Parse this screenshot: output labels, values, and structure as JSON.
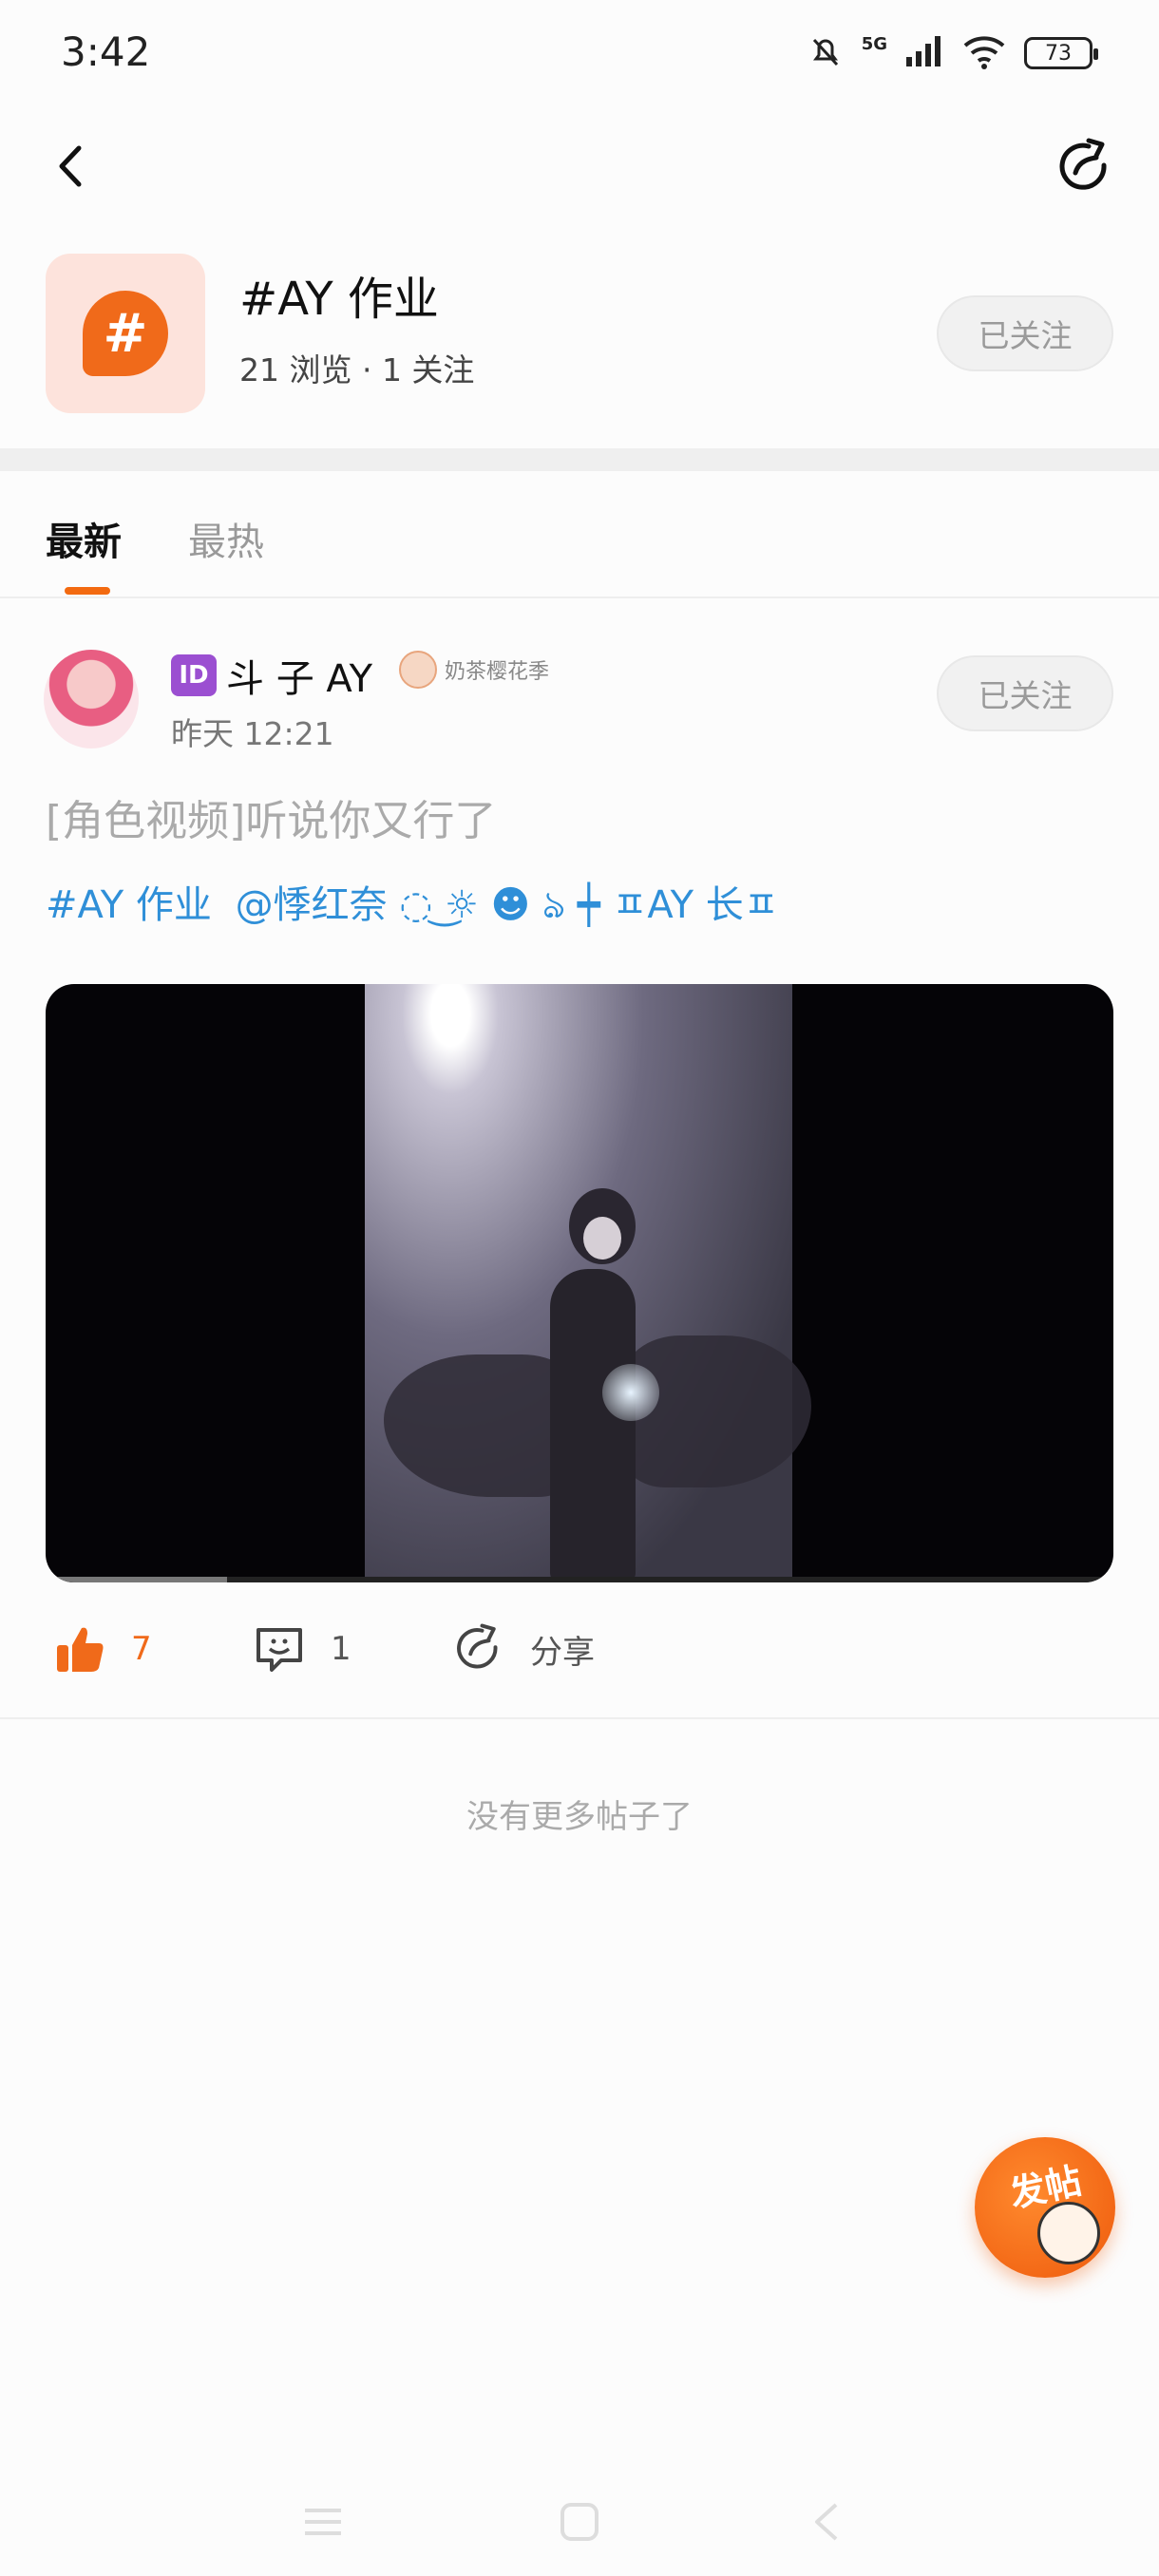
{
  "status_bar": {
    "time": "3:42",
    "network": "5G",
    "battery": "73"
  },
  "nav": {
    "back_icon": "back-arrow-icon",
    "share_icon": "share-icon"
  },
  "topic": {
    "logo_symbol": "#",
    "title": "#AY 作业",
    "stats": "21 浏览 · 1 关注",
    "follow_label": "已关注"
  },
  "tabs": [
    {
      "label": "最新",
      "active": true
    },
    {
      "label": "最热",
      "active": false
    }
  ],
  "post": {
    "author": {
      "id_badge": "ID",
      "name": "斗 子  AY",
      "badge_text": "奶茶樱花季"
    },
    "time": "昨天 12:21",
    "follow_label": "已关注",
    "title": "[角色视频]听说你又行了",
    "tags": [
      "#AY 作业",
      "@悸红奈 ◌ ͜☼ ☻ ঌ ┿ ㅍAY 长ㅍ"
    ],
    "video": {
      "progress": 0.17
    },
    "actions": {
      "like_count": "7",
      "comment_count": "1",
      "share_label": "分享"
    }
  },
  "end_message": "没有更多帖子了",
  "fab": {
    "label": "发帖"
  },
  "colors": {
    "accent": "#f06a1a",
    "link": "#2f8fd8",
    "follow_bg": "#f1f1f1"
  }
}
